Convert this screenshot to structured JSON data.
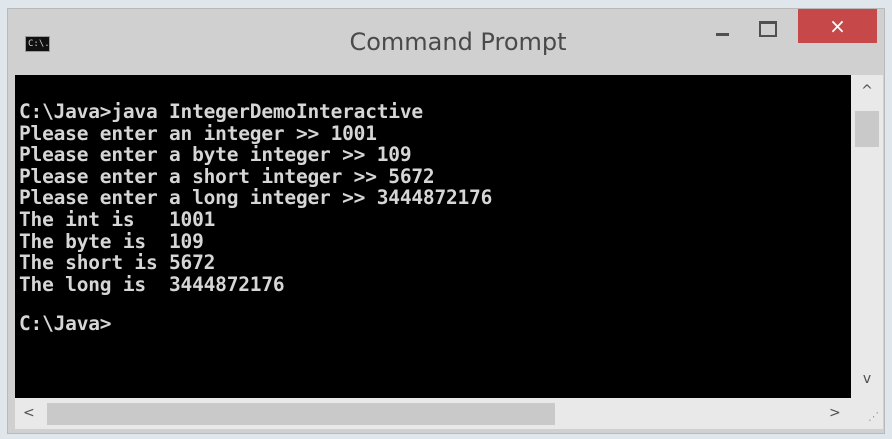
{
  "window": {
    "title": "Command Prompt",
    "icon_text": "C:\\.",
    "controls": {
      "minimize": "minimize",
      "maximize": "maximize",
      "close": "×"
    }
  },
  "console": {
    "lines": [
      "C:\\Java>java IntegerDemoInteractive",
      "Please enter an integer >> 1001",
      "Please enter a byte integer >> 109",
      "Please enter a short integer >> 5672",
      "Please enter a long integer >> 3444872176",
      "The int is   1001",
      "The byte is  109",
      "The short is 5672",
      "The long is  3444872176"
    ],
    "prompt": "C:\\Java>"
  },
  "scrollbars": {
    "up_arrow": "^",
    "down_arrow": "v",
    "left_arrow": "<",
    "right_arrow": ">"
  },
  "icons": {
    "app": "cmd-icon",
    "grip": "resize-grip-icon"
  }
}
